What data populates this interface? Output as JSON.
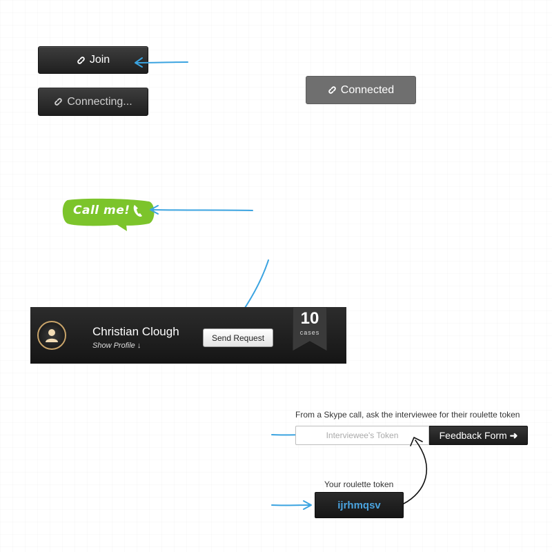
{
  "join_button": {
    "label": "Join",
    "icon": "link-icon"
  },
  "connecting_button": {
    "label": "Connecting...",
    "icon": "link-icon"
  },
  "connected_button": {
    "label": "Connected",
    "icon": "link-icon"
  },
  "callme_bubble": {
    "label": "Call me!",
    "icon": "phone-icon",
    "color": "#7cc42b"
  },
  "profile": {
    "name": "Christian Clough",
    "show_profile_label": "Show Profile",
    "send_request_label": "Send Request",
    "cases_count": "10",
    "cases_label": "cases"
  },
  "token": {
    "prompt": "From a Skype call, ask the interviewee for their roulette token",
    "input_placeholder": "Interviewee's Token",
    "feedback_button_label": "Feedback Form",
    "your_token_label": "Your roulette token",
    "your_token_value": "ijrhmqsv"
  },
  "colors": {
    "annotation_arrow": "#3aa3e0",
    "token_text": "#4aa3df"
  }
}
